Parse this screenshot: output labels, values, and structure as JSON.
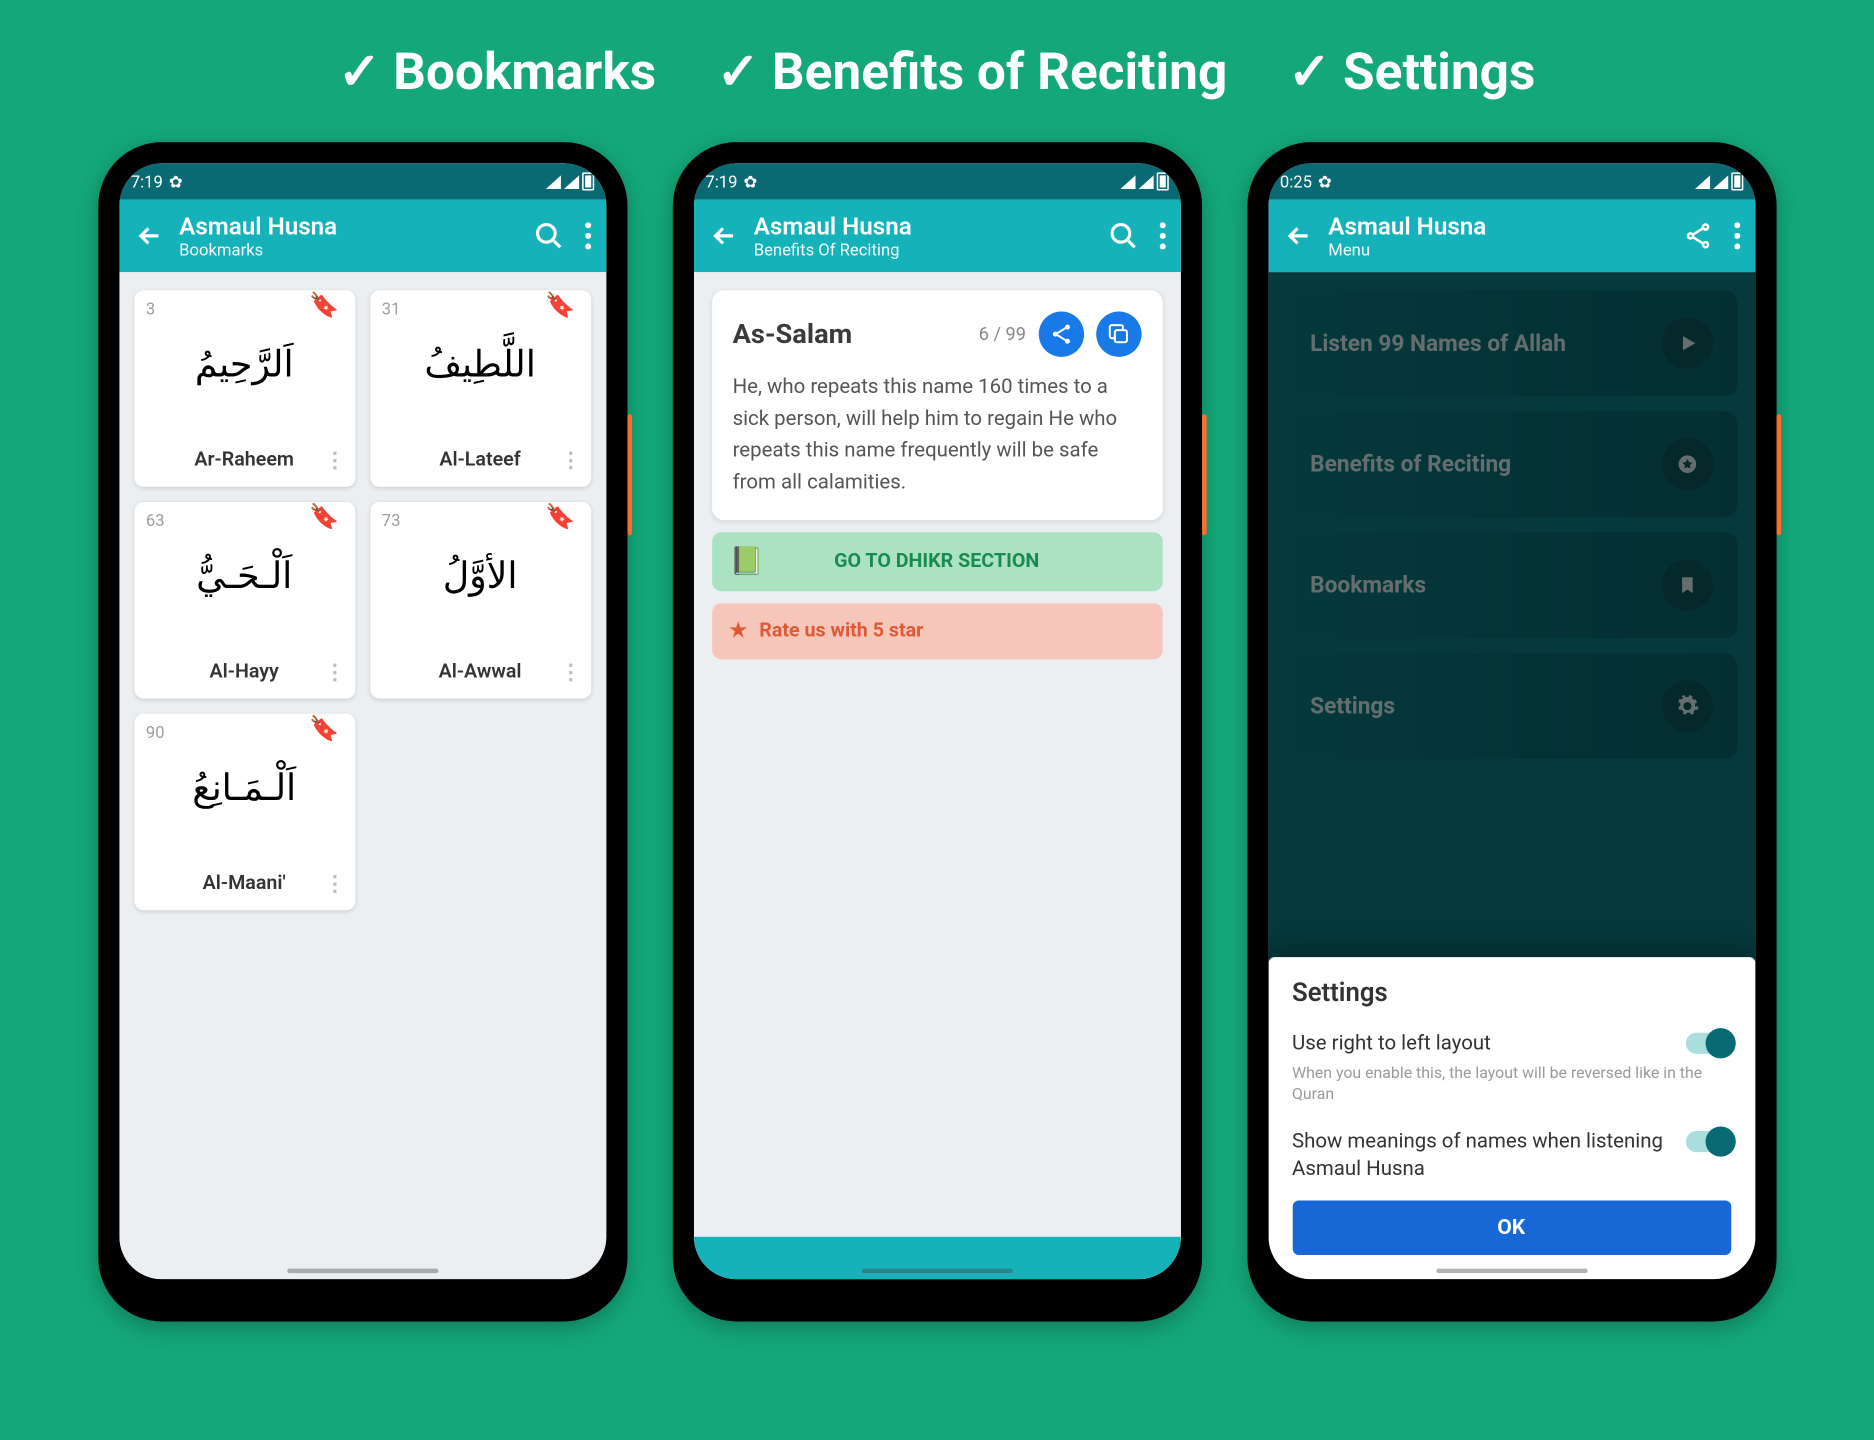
{
  "headline": {
    "bookmarks": "Bookmarks",
    "benefits": "Benefits of Reciting",
    "settings": "Settings"
  },
  "phone1": {
    "time": "7:19",
    "title": "Asmaul Husna",
    "subtitle": "Bookmarks",
    "cards": [
      {
        "num": "3",
        "arabic": "اَلرَّحِيمُ",
        "name": "Ar-Raheem"
      },
      {
        "num": "31",
        "arabic": "اللَّطِيفُ",
        "name": "Al-Lateef"
      },
      {
        "num": "63",
        "arabic": "اَلْـحَـيُّ",
        "name": "Al-Hayy"
      },
      {
        "num": "73",
        "arabic": "الأوَّلُ",
        "name": "Al-Awwal"
      },
      {
        "num": "90",
        "arabic": "اَلْـمَـانِعُ",
        "name": "Al-Maani'"
      }
    ]
  },
  "phone2": {
    "time": "7:19",
    "title": "Asmaul Husna",
    "subtitle": "Benefits Of Reciting",
    "name": "As-Salam",
    "counter": "6 / 99",
    "body": "He, who repeats this name 160 times to a sick person, will help him to regain  He who repeats this name frequently will be safe from all calamities.",
    "go_label": "GO TO DHIKR SECTION",
    "rate_label": "Rate us with 5 star"
  },
  "phone3": {
    "time": "0:25",
    "title": "Asmaul Husna",
    "subtitle": "Menu",
    "menu": [
      {
        "label": "Listen 99 Names of Allah",
        "icon": "play"
      },
      {
        "label": "Benefits of Reciting",
        "icon": "star"
      },
      {
        "label": "Bookmarks",
        "icon": "bookmark"
      },
      {
        "label": "Settings",
        "icon": "gear"
      }
    ],
    "sheet": {
      "title": "Settings",
      "rtl_label": "Use right to left layout",
      "rtl_hint": "When you enable this, the layout will be reversed like in the Quran",
      "meanings_label": "Show meanings of names when listening Asmaul Husna",
      "ok": "OK"
    }
  }
}
